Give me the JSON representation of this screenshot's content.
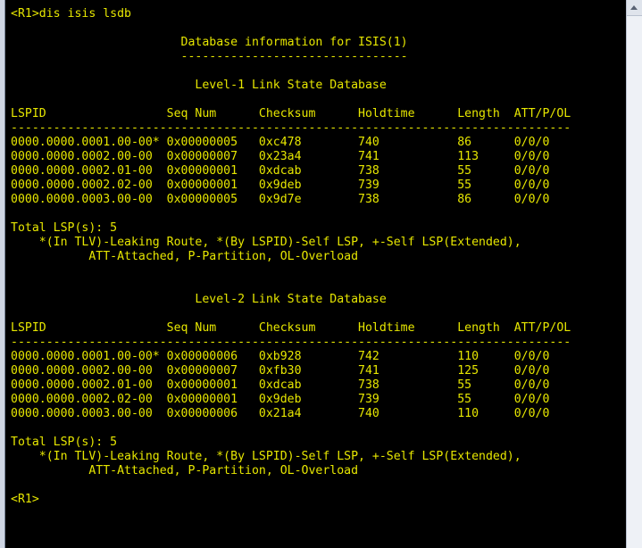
{
  "terminal": {
    "lines": [
      "<R1>dis isis lsdb",
      "",
      "                        Database information for ISIS(1)",
      "                        --------------------------------",
      "",
      "                          Level-1 Link State Database",
      "",
      "LSPID                 Seq Num      Checksum      Holdtime      Length  ATT/P/OL",
      "-------------------------------------------------------------------------------",
      "0000.0000.0001.00-00* 0x00000005   0xc478        740           86      0/0/0",
      "0000.0000.0002.00-00  0x00000007   0x23a4        741           113     0/0/0",
      "0000.0000.0002.01-00  0x00000001   0xdcab        738           55      0/0/0",
      "0000.0000.0002.02-00  0x00000001   0x9deb        739           55      0/0/0",
      "0000.0000.0003.00-00  0x00000005   0x9d7e        738           86      0/0/0",
      "",
      "Total LSP(s): 5",
      "    *(In TLV)-Leaking Route, *(By LSPID)-Self LSP, +-Self LSP(Extended),",
      "           ATT-Attached, P-Partition, OL-Overload",
      "",
      "",
      "                          Level-2 Link State Database",
      "",
      "LSPID                 Seq Num      Checksum      Holdtime      Length  ATT/P/OL",
      "-------------------------------------------------------------------------------",
      "0000.0000.0001.00-00* 0x00000006   0xb928        742           110     0/0/0",
      "0000.0000.0002.00-00  0x00000007   0xfb30        741           125     0/0/0",
      "0000.0000.0002.01-00  0x00000001   0xdcab        738           55      0/0/0",
      "0000.0000.0002.02-00  0x00000001   0x9deb        739           55      0/0/0",
      "0000.0000.0003.00-00  0x00000006   0x21a4        740           110     0/0/0",
      "",
      "Total LSP(s): 5",
      "    *(In TLV)-Leaking Route, *(By LSPID)-Self LSP, +-Self LSP(Extended),",
      "           ATT-Attached, P-Partition, OL-Overload",
      "",
      "<R1>"
    ]
  },
  "colors": {
    "text": "#e6e600",
    "background": "#000000"
  }
}
